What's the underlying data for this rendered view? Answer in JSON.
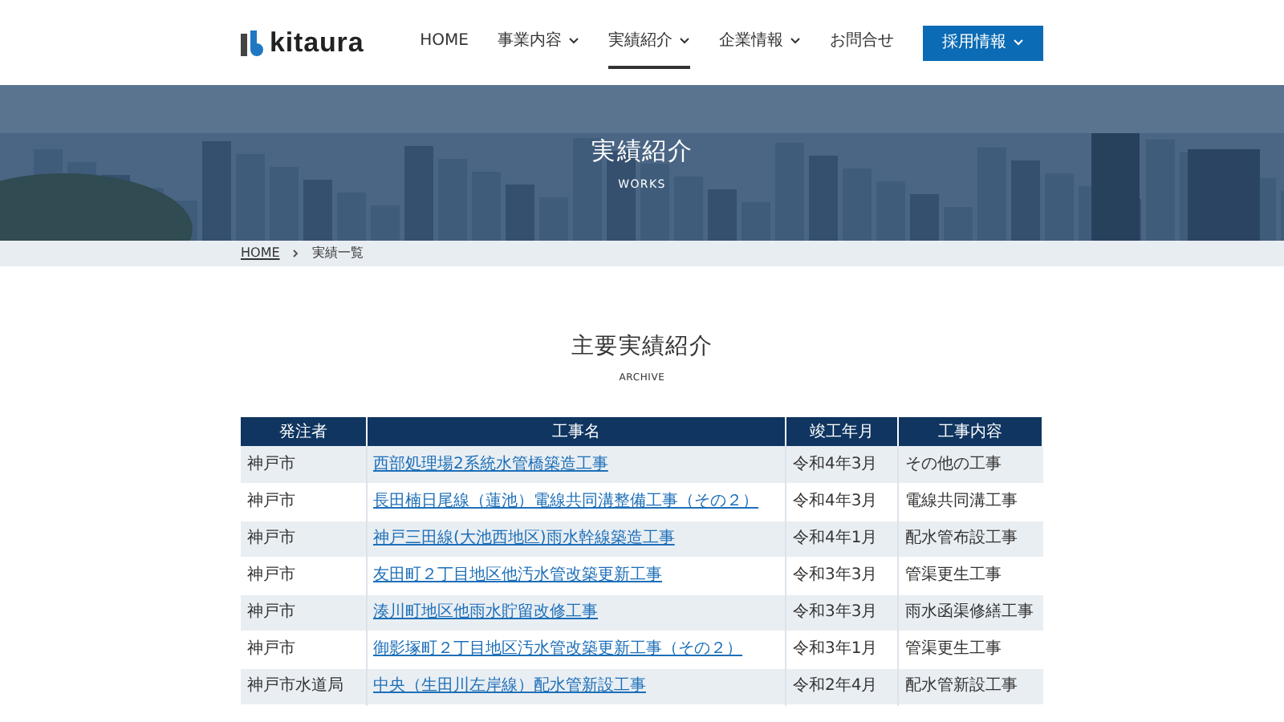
{
  "header": {
    "logo": "kitaura",
    "nav": [
      {
        "label": "HOME",
        "dropdown": false,
        "selected": false
      },
      {
        "label": "事業内容",
        "dropdown": true,
        "selected": false
      },
      {
        "label": "実績紹介",
        "dropdown": true,
        "selected": true
      },
      {
        "label": "企業情報",
        "dropdown": true,
        "selected": false
      },
      {
        "label": "お問合せ",
        "dropdown": false,
        "selected": false
      }
    ],
    "cta": {
      "label": "採用情報",
      "dropdown": true
    }
  },
  "hero": {
    "title": "実績紹介",
    "subtitle": "WORKS"
  },
  "breadcrumb": [
    {
      "label": "HOME",
      "link": true
    },
    {
      "label": "実績一覧",
      "link": false
    }
  ],
  "section": {
    "title": "主要実績紹介",
    "subtitle": "ARCHIVE"
  },
  "table": {
    "columns": [
      "発注者",
      "工事名",
      "竣工年月",
      "工事内容"
    ],
    "rows": [
      {
        "client": "神戸市",
        "name": "西部処理場2系統水管橋築造工事",
        "date": "令和4年3月",
        "type": "その他の工事"
      },
      {
        "client": "神戸市",
        "name": "長田楠日尾線（蓮池）電線共同溝整備工事（その２）",
        "date": "令和4年3月",
        "type": "電線共同溝工事"
      },
      {
        "client": "神戸市",
        "name": "神戸三田線(大池西地区)雨水幹線築造工事",
        "date": "令和4年1月",
        "type": "配水管布設工事"
      },
      {
        "client": "神戸市",
        "name": "友田町２丁目地区他汚水管改築更新工事",
        "date": "令和3年3月",
        "type": "管渠更生工事"
      },
      {
        "client": "神戸市",
        "name": "湊川町地区他雨水貯留改修工事",
        "date": "令和3年3月",
        "type": "雨水函渠修繕工事"
      },
      {
        "client": "神戸市",
        "name": "御影塚町２丁目地区汚水管改築更新工事（その２）",
        "date": "令和3年1月",
        "type": "管渠更生工事"
      },
      {
        "client": "神戸市水道局",
        "name": "中央（生田川左岸線）配水管新設工事",
        "date": "令和2年4月",
        "type": "配水管新設工事"
      }
    ]
  }
}
